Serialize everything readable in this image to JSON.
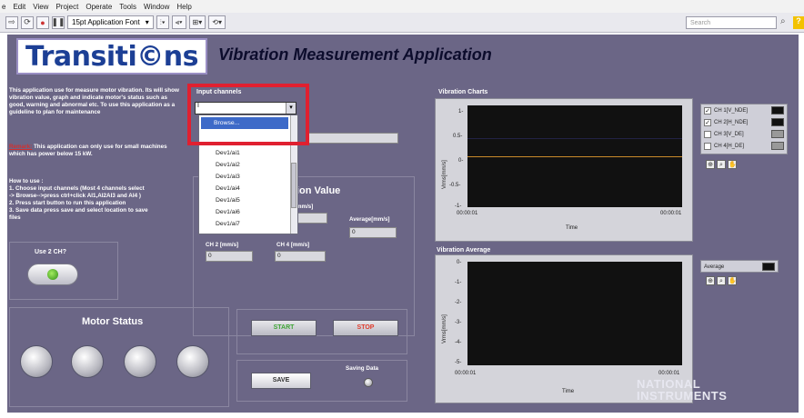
{
  "menubar": {
    "items": [
      "e",
      "Edit",
      "View",
      "Project",
      "Operate",
      "Tools",
      "Window",
      "Help"
    ]
  },
  "toolbar": {
    "font": "15pt Application Font",
    "search_placeholder": "Search"
  },
  "header": {
    "logo_text": "Transiti©ns",
    "app_title": "Vibration Measurement Application"
  },
  "left": {
    "description": "This application use for measure motor vibration. Its will show vibration value, graph and indicate motor's status such as good, warning and abnormal etc. To use this application as a guideline to plan for maintenance",
    "remark_label": "Remark:",
    "remark_text": "This application can only use for small machines which has power below 15 kW.",
    "howto_title": "How to use :",
    "howto_lines": [
      "1. Choose input channels (Most 4 channels select",
      "-> Browse-->press ctrl+click AI1,AI2AI3 and AI4 )",
      "2. Press start button to run this application",
      "3. Save data press save and select location to save",
      "   files"
    ],
    "ch7_label": "Use 2 CH?"
  },
  "input_channels": {
    "label": "Input channels",
    "value": "I",
    "dropdown_items": [
      "Browse...",
      "Dev1/ai1",
      "Dev1/ai2",
      "Dev1/ai3",
      "Dev1/ai4",
      "Dev1/ai5",
      "Dev1/ai6",
      "Dev1/ai7"
    ]
  },
  "vibration_value": {
    "title": "ion Value",
    "ch1_label": "[mm/s]",
    "ch2_label": "CH 2 [mm/s]",
    "ch4_label": "CH 4 [mm/s]",
    "avg_label": "Average[mm/s]",
    "ch2_value": "0",
    "ch4_value": "0",
    "avg_value": "0"
  },
  "motor": {
    "title": "Motor Status"
  },
  "controls": {
    "start": "START",
    "stop": "STOP",
    "save": "SAVE",
    "saving_label": "Saving Data"
  },
  "charts": {
    "vib_title": "Vibration Charts",
    "vib_ylabel": "Vrms[mm/s]",
    "vib_xlabel": "Time",
    "vib_yticks": [
      "1-",
      "0.5-",
      "0-",
      "-0.5-",
      "-1-"
    ],
    "vib_xmin": "00:00:01",
    "vib_xmax": "00:00:01",
    "vib_legend": [
      {
        "label": "CH 1[V_NDE]",
        "checked": true
      },
      {
        "label": "CH 2[H_NDE]",
        "checked": true
      },
      {
        "label": "CH 3[V_DE]",
        "checked": false
      },
      {
        "label": "CH 4[H_DE]",
        "checked": false
      }
    ],
    "avg_title": "Vibration Average",
    "avg_ylabel": "Vrms[mm/s]",
    "avg_xlabel": "Time",
    "avg_yticks": [
      "0-",
      "-1-",
      "-2-",
      "-3-",
      "-4-",
      "-5-"
    ],
    "avg_xmin": "00:00:01",
    "avg_xmax": "00:00:01",
    "avg_legend": "Average"
  },
  "footer": {
    "ni_line1": "NATIONAL",
    "ni_line2": "INSTRUMENTS"
  }
}
